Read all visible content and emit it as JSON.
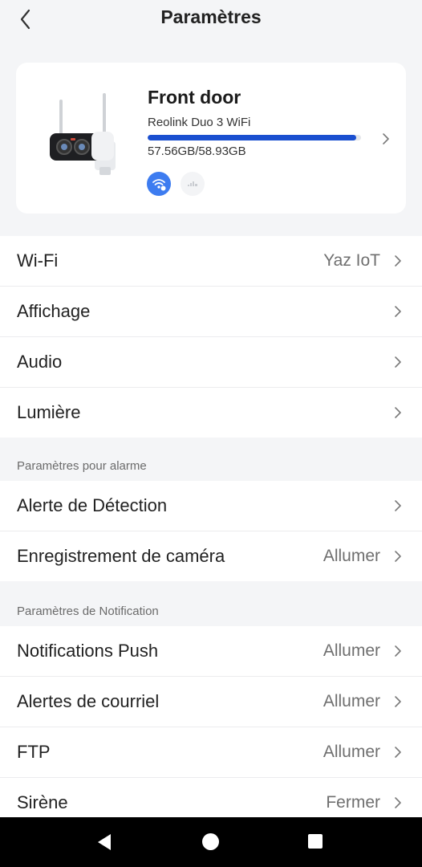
{
  "header": {
    "title": "Paramètres"
  },
  "device": {
    "name": "Front door",
    "model": "Reolink Duo 3 WiFi",
    "storage": "57.56GB/58.93GB",
    "storage_fraction": 0.977,
    "accent_color": "#1a4fd0"
  },
  "general_rows": [
    {
      "label": "Wi-Fi",
      "value": "Yaz IoT"
    },
    {
      "label": "Affichage",
      "value": ""
    },
    {
      "label": "Audio",
      "value": ""
    },
    {
      "label": "Lumière",
      "value": ""
    }
  ],
  "alarm_section": {
    "title": "Paramètres pour alarme",
    "rows": [
      {
        "label": "Alerte de Détection",
        "value": ""
      },
      {
        "label": "Enregistrement de caméra",
        "value": "Allumer"
      }
    ]
  },
  "notification_section": {
    "title": "Paramètres de Notification",
    "rows": [
      {
        "label": "Notifications Push",
        "value": "Allumer"
      },
      {
        "label": "Alertes de courriel",
        "value": "Allumer"
      },
      {
        "label": "FTP",
        "value": "Allumer"
      },
      {
        "label": "Sirène",
        "value": "Fermer"
      }
    ]
  }
}
